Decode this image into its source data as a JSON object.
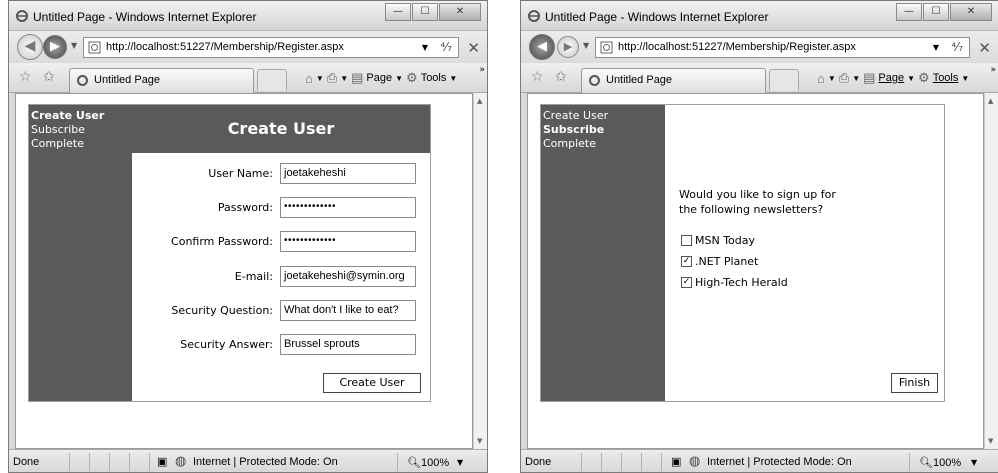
{
  "left_window": {
    "title": "Untitled Page - Windows Internet Explorer",
    "address": "http://localhost:51227/Membership/Register.aspx",
    "tab_label": "Untitled Page",
    "page_label": "Page",
    "tools_label": "Tools",
    "status": {
      "done": "Done",
      "zone": "Internet | Protected Mode: On",
      "zoom": "100%"
    },
    "wizard": {
      "sidebar": [
        "Create User",
        "Subscribe",
        "Complete"
      ],
      "active_step": 0,
      "header": "Create User",
      "fields": [
        {
          "label": "User Name:",
          "value": "joetakeheshi"
        },
        {
          "label": "Password:",
          "value": "•••••••••••••"
        },
        {
          "label": "Confirm Password:",
          "value": "•••••••••••••"
        },
        {
          "label": "E-mail:",
          "value": "joetakeheshi@symin.org"
        },
        {
          "label": "Security Question:",
          "value": "What don't I like to eat?"
        },
        {
          "label": "Security Answer:",
          "value": "Brussel sprouts"
        }
      ],
      "button": "Create User"
    }
  },
  "right_window": {
    "title": "Untitled Page - Windows Internet Explorer",
    "address": "http://localhost:51227/Membership/Register.aspx",
    "tab_label": "Untitled Page",
    "page_label": "Page",
    "tools_label": "Tools",
    "status": {
      "done": "Done",
      "zone": "Internet | Protected Mode: On",
      "zoom": "100%"
    },
    "wizard": {
      "sidebar": [
        "Create User",
        "Subscribe",
        "Complete"
      ],
      "active_step": 1,
      "question_line1": "Would you like to sign up for",
      "question_line2": "the following newsletters?",
      "newsletters": [
        {
          "label": "MSN Today",
          "checked": false
        },
        {
          "label": ".NET Planet",
          "checked": true
        },
        {
          "label": "High-Tech Herald",
          "checked": true
        }
      ],
      "button": "Finish"
    }
  }
}
